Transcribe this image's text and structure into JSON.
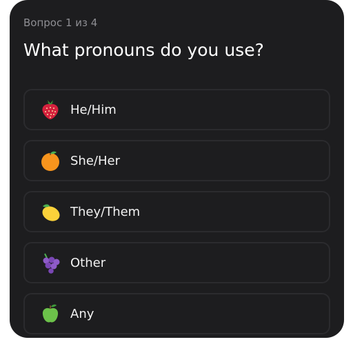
{
  "counter": "Вопрос 1 из 4",
  "question": "What pronouns do you use?",
  "options": [
    {
      "label": "He/Him",
      "icon": "strawberry-icon"
    },
    {
      "label": "She/Her",
      "icon": "orange-icon"
    },
    {
      "label": "They/Them",
      "icon": "lemon-icon"
    },
    {
      "label": "Other",
      "icon": "grapes-icon"
    },
    {
      "label": "Any",
      "icon": "apple-icon"
    }
  ],
  "colors": {
    "card_background": "#1d1d1f",
    "option_border": "#2b2b2e",
    "counter_text": "#8e8e93",
    "question_text": "#ffffff"
  }
}
